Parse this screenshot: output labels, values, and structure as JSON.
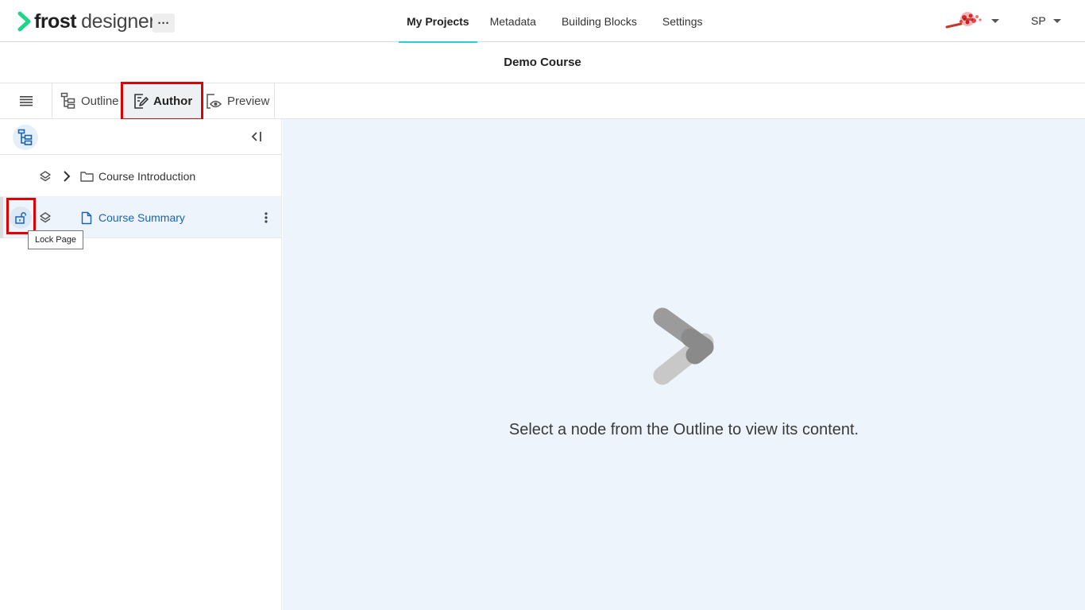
{
  "header": {
    "brand_bold": "frost",
    "brand_light": "designer",
    "more_label": "···",
    "nav": [
      {
        "label": "My Projects",
        "active": true
      },
      {
        "label": "Metadata",
        "active": false
      },
      {
        "label": "Building Blocks",
        "active": false
      },
      {
        "label": "Settings",
        "active": false
      }
    ],
    "user_initials": "SP"
  },
  "course": {
    "title": "Demo Course"
  },
  "toolbar": {
    "tabs": [
      {
        "label": "Outline",
        "active": false
      },
      {
        "label": "Author",
        "active": true
      },
      {
        "label": "Preview",
        "active": false
      }
    ]
  },
  "outline": {
    "items": [
      {
        "label": "Course Introduction",
        "type": "folder",
        "selected": false
      },
      {
        "label": "Course Summary",
        "type": "page",
        "selected": true
      }
    ],
    "tooltip": "Lock Page"
  },
  "main": {
    "empty_message": "Select a node from the Outline to view its content."
  },
  "colors": {
    "brand_green": "#1ed68a",
    "accent_cyan": "#33c9d9",
    "link_blue": "#1565b4",
    "highlight_red": "#e00000"
  }
}
